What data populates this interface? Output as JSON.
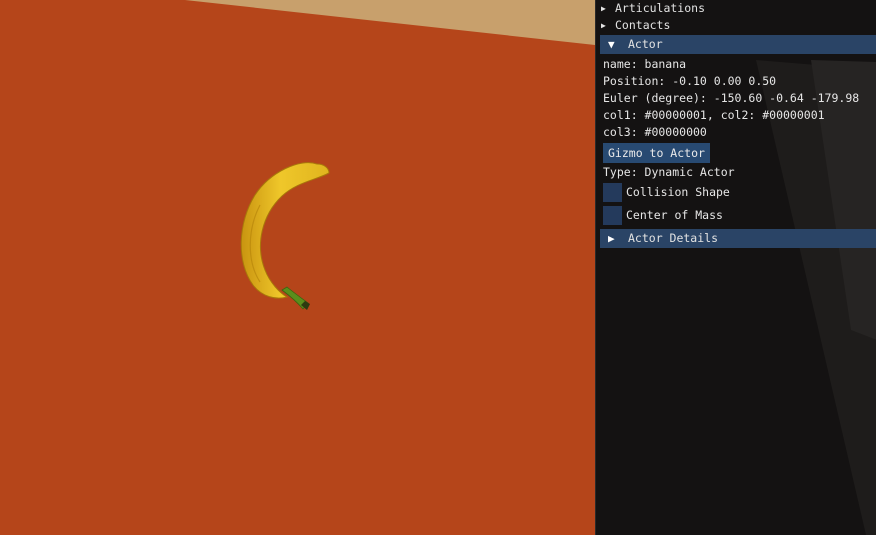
{
  "viewport": {
    "floor_color": "#b5451a",
    "wall_color": "#c8a06c",
    "object": "banana"
  },
  "panel": {
    "articulations_label": "Articulations",
    "contacts_label": "Contacts",
    "actor_header": "Actor",
    "actor": {
      "name": "name: banana",
      "position": "Position: -0.10 0.00 0.50",
      "euler": "Euler (degree): -150.60 -0.64 -179.98",
      "col1_col2": "col1: #00000001, col2: #00000001",
      "col3": "col3: #00000000",
      "gizmo_button": "Gizmo to Actor",
      "type": "Type: Dynamic Actor",
      "collision_shape_label": "Collision Shape",
      "collision_shape_checked": false,
      "center_of_mass_label": "Center of Mass",
      "center_of_mass_checked": false
    },
    "actor_details_header": "Actor Details",
    "header_color": "#2a4466",
    "button_color": "#284a72"
  }
}
